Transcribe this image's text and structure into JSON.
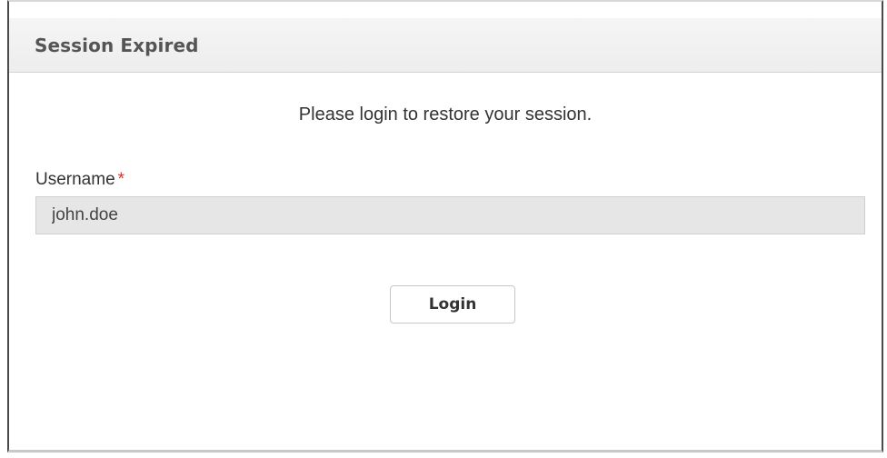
{
  "dialog": {
    "title": "Session Expired",
    "message": "Please login to restore your session.",
    "username": {
      "label": "Username",
      "required_mark": "*",
      "value": "john.doe"
    },
    "login_label": "Login"
  },
  "colors": {
    "header_background": "#efefef",
    "required_mark": "#d9342b",
    "input_background": "#e6e6e6",
    "frame_border": "#4a4a4a"
  }
}
